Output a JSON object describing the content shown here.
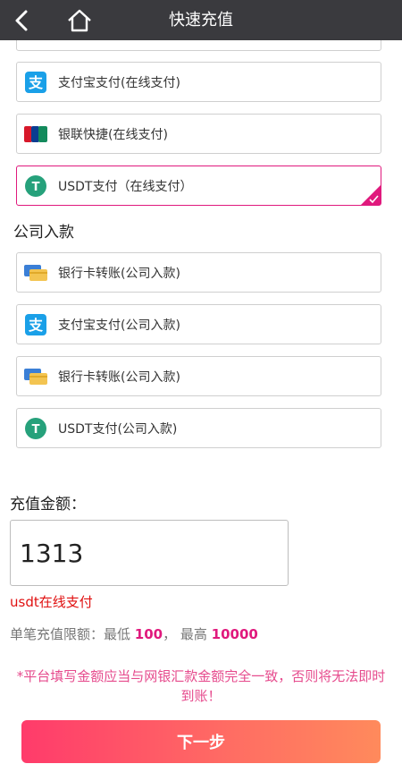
{
  "header": {
    "title": "快速充值"
  },
  "online": {
    "options": [
      {
        "label": "支付宝支付(在线支付)",
        "icon": "alipay-icon"
      },
      {
        "label": "银联快捷(在线支付)",
        "icon": "unionpay-icon"
      },
      {
        "label": "USDT支付（在线支付）",
        "icon": "usdt-icon",
        "selected": true
      }
    ]
  },
  "company": {
    "title": "公司入款",
    "options": [
      {
        "label": "银行卡转账(公司入款)",
        "icon": "bank-card-icon"
      },
      {
        "label": "支付宝支付(公司入款)",
        "icon": "alipay-icon"
      },
      {
        "label": "银行卡转账(公司入款)",
        "icon": "bank-card-icon"
      },
      {
        "label": "USDT支付(公司入款)",
        "icon": "usdt-icon"
      }
    ]
  },
  "amount": {
    "label": "充值金额：",
    "value": "1313",
    "method_note": "usdt在线支付",
    "limit_prefix": "单笔充值限额：最低",
    "min": "100",
    "sep": "，  最高",
    "max": "10000"
  },
  "warning": "*平台填写金额应当与网银汇款金额完全一致，否则将无法即时到账！",
  "next_button": "下一步",
  "colors": {
    "header_bg": "#3a3a3e",
    "accent": "#e0197d",
    "button_start": "#ff3b6b",
    "button_end": "#ff8a5c"
  }
}
